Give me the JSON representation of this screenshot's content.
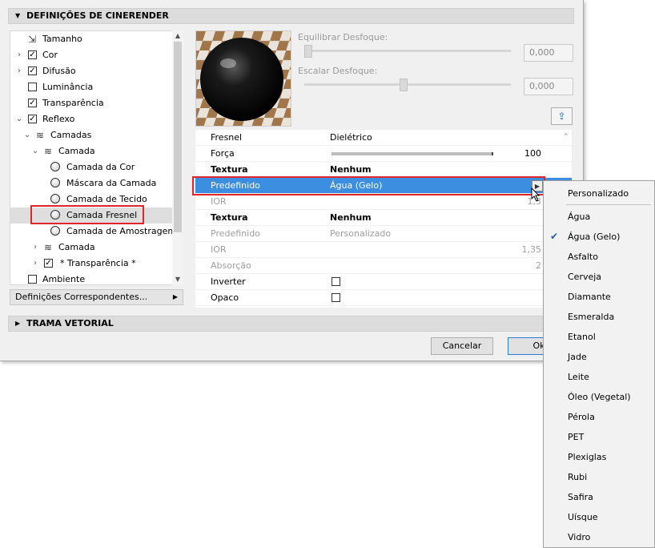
{
  "sections": {
    "cinerender": "DEFINIÇÕES DE CINERENDER",
    "vector": "TRAMA VETORIAL"
  },
  "tree": [
    {
      "label": "Tamanho",
      "icon": "resize-icon"
    },
    {
      "label": "Cor",
      "checked": true
    },
    {
      "label": "Difusão",
      "checked": true
    },
    {
      "label": "Luminância",
      "checked": false
    },
    {
      "label": "Transparência",
      "checked": true
    },
    {
      "label": "Reflexo",
      "checked": true
    },
    {
      "label": "Camadas",
      "icon": "layers-icon"
    },
    {
      "label": "Camada",
      "icon": "layer-icon"
    },
    {
      "label": "Camada da Cor",
      "icon": "sphere-icon"
    },
    {
      "label": "Máscara da Camada",
      "icon": "sphere-icon"
    },
    {
      "label": "Camada de Tecido",
      "icon": "sphere-icon"
    },
    {
      "label": "Camada Fresnel",
      "icon": "sphere-icon"
    },
    {
      "label": "Camada de Amostragem",
      "icon": "sphere-icon"
    },
    {
      "label": "Camada",
      "icon": "layer-icon"
    },
    {
      "label": "* Transparência *",
      "checked": true
    },
    {
      "label": "Ambiente",
      "checked": false
    }
  ],
  "matching_settings": "Definições Correspondentes...",
  "blur": {
    "balance_label": "Equilibrar Desfoque:",
    "balance_value": "0,000",
    "balance_level": 0.0,
    "scale_label": "Escalar Desfoque:",
    "scale_value": "0,000",
    "scale_level": 0.5
  },
  "props": {
    "fresnel_k": "Fresnel",
    "fresnel_v": "Dielétrico",
    "forca_k": "Força",
    "forca_v": "100",
    "forca_level": 1.0,
    "textura1_k": "Textura",
    "textura1_v": "Nenhum",
    "pred1_k": "Predefinido",
    "pred1_v": "Água (Gelo)",
    "ior1_k": "IOR",
    "ior1_v": "1,3",
    "textura2_k": "Textura",
    "textura2_v": "Nenhum",
    "pred2_k": "Predefinido",
    "pred2_v": "Personalizado",
    "ior2_k": "IOR",
    "ior2_v": "1,35",
    "abs_k": "Absorção",
    "abs_v": "2",
    "inv_k": "Inverter",
    "opaco_k": "Opaco"
  },
  "buttons": {
    "cancel": "Cancelar",
    "ok": "Ok"
  },
  "menu": {
    "header": "Personalizado",
    "items": [
      "Água",
      "Água (Gelo)",
      "Asfalto",
      "Cerveja",
      "Diamante",
      "Esmeralda",
      "Etanol",
      "Jade",
      "Leite",
      "Óleo (Vegetal)",
      "Pérola",
      "PET",
      "Plexiglas",
      "Rubi",
      "Safira",
      "Uísque",
      "Vidro"
    ],
    "selected": "Água (Gelo)"
  }
}
